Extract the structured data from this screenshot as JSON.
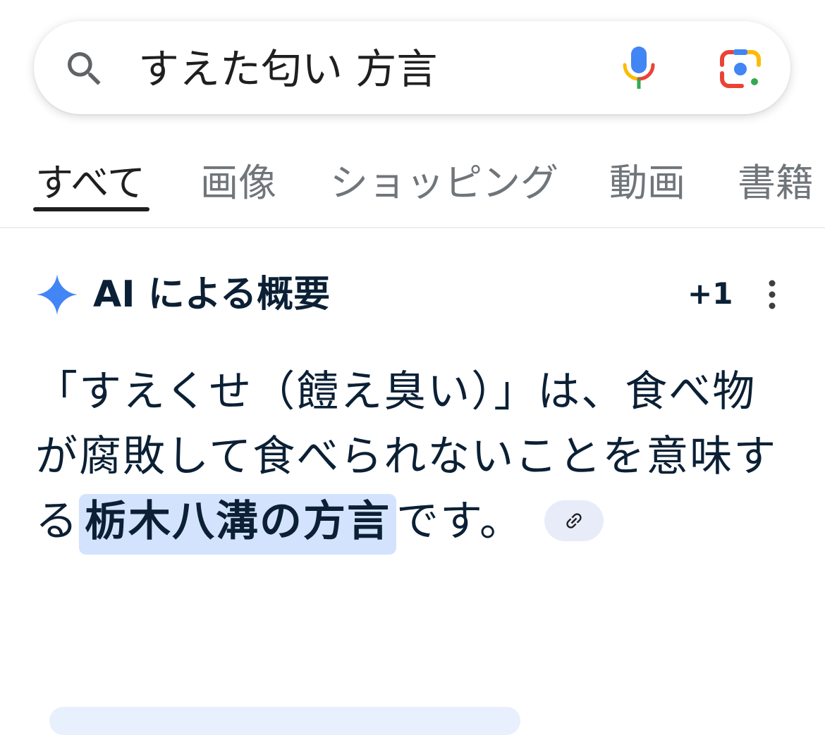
{
  "search": {
    "query": "すえた匂い 方言",
    "icons": {
      "search": "search-icon",
      "voice": "mic-icon",
      "lens": "google-lens-icon"
    }
  },
  "tabs": [
    {
      "label": "すべて",
      "active": true
    },
    {
      "label": "画像",
      "active": false
    },
    {
      "label": "ショッピング",
      "active": false
    },
    {
      "label": "動画",
      "active": false
    },
    {
      "label": "書籍",
      "active": false
    }
  ],
  "ai_overview": {
    "title": "AI による概要",
    "source_count": "+1",
    "summary_before": "「すえくせ（饐え臭い）」は、食べ物が腐敗して食べられないことを意味する",
    "summary_highlight": "栃木八溝の方言",
    "summary_after": "です。",
    "icons": {
      "sparkle": "ai-sparkle-icon",
      "more": "more-vert-icon",
      "link": "link-icon"
    }
  },
  "colors": {
    "highlight": "#d3e3fd",
    "ai_text": "#0b2035",
    "sparkle": "#4285f4",
    "inactive_tab": "#70757a"
  }
}
